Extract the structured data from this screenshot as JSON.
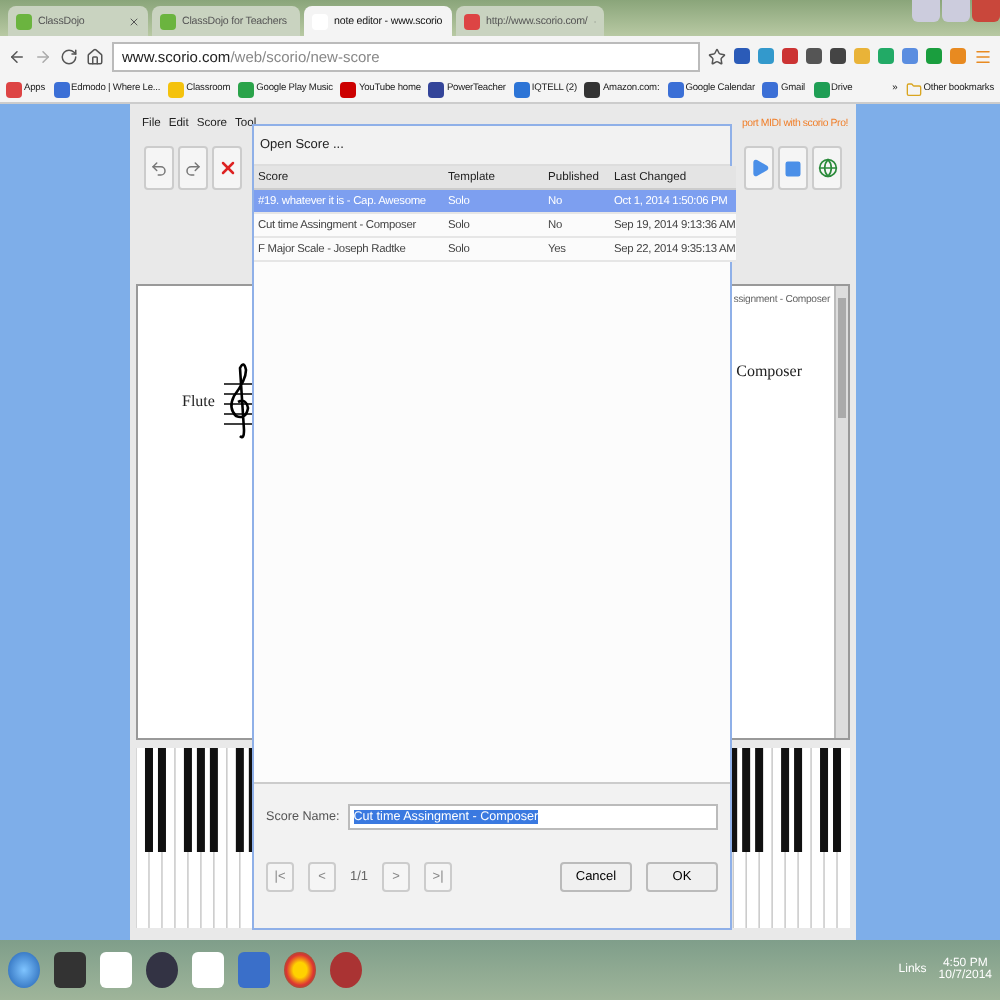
{
  "browser": {
    "tabs": [
      {
        "label": "ClassDojo",
        "selected": false
      },
      {
        "label": "ClassDojo for Teachers",
        "selected": false
      },
      {
        "label": "note editor - www.scorio",
        "selected": true
      },
      {
        "label": "http://www.scorio.com/",
        "selected": false
      }
    ],
    "url_host": "www.scorio.com",
    "url_path": "/web/scorio/new-score",
    "bookmarks": [
      "Apps",
      "Edmodo | Where Le...",
      "Classroom",
      "Google Play Music",
      "YouTube home",
      "PowerTeacher",
      "IQTELL (2)",
      "Amazon.com:",
      "Google Calendar",
      "Gmail",
      "Drive"
    ],
    "overflow": "»",
    "other_bookmarks": "Other bookmarks"
  },
  "app": {
    "menu": [
      "File",
      "Edit",
      "Score",
      "Tool"
    ],
    "promo": "port MIDI with scorio Pro!",
    "score": {
      "title": "ssignment - Composer",
      "composer": "Composer",
      "instrument": "Flute"
    }
  },
  "dialog": {
    "title": "Open Score ...",
    "columns": [
      "Score",
      "Template",
      "Published",
      "Last Changed"
    ],
    "rows": [
      {
        "score": "#19. whatever it is - Cap. Awesome",
        "template": "Solo",
        "published": "No",
        "last_changed": "Oct 1, 2014 1:50:06 PM",
        "selected": true
      },
      {
        "score": "Cut time Assingment - Composer",
        "template": "Solo",
        "published": "No",
        "last_changed": "Sep 19, 2014 9:13:36 AM",
        "selected": false
      },
      {
        "score": "F Major Scale - Joseph Radtke",
        "template": "Solo",
        "published": "Yes",
        "last_changed": "Sep 22, 2014 9:35:13 AM",
        "selected": false
      }
    ],
    "score_name_label": "Score Name:",
    "score_name": "Cut time Assingment - Composer",
    "pager": {
      "first": "|<",
      "prev": "<",
      "page": "1/1",
      "next": ">",
      "last": ">|"
    },
    "buttons": [
      "Cancel",
      "OK"
    ]
  },
  "taskbar": {
    "links": "Links",
    "time": "4:50 PM",
    "date": "10/7/2014"
  }
}
